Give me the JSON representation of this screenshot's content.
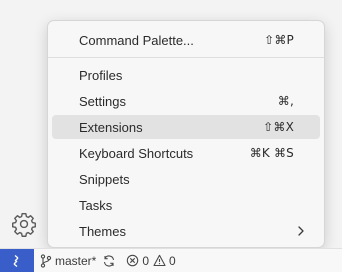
{
  "menu": {
    "items": [
      {
        "label": "Command Palette...",
        "shortcut": "⇧⌘P"
      },
      {
        "label": "Profiles",
        "shortcut": ""
      },
      {
        "label": "Settings",
        "shortcut": "⌘,"
      },
      {
        "label": "Extensions",
        "shortcut": "⇧⌘X"
      },
      {
        "label": "Keyboard Shortcuts",
        "shortcut": "⌘K ⌘S"
      },
      {
        "label": "Snippets",
        "shortcut": ""
      },
      {
        "label": "Tasks",
        "shortcut": ""
      },
      {
        "label": "Themes",
        "shortcut": ""
      }
    ]
  },
  "statusbar": {
    "branch": "master*",
    "errors": "0",
    "warnings": "0"
  },
  "icons": {
    "manage": "gear-icon",
    "remote": "remote-icon",
    "branch": "git-branch-icon",
    "sync": "sync-icon",
    "errors": "error-icon",
    "warnings": "warning-icon",
    "submenu": "chevron-right-icon"
  },
  "colors": {
    "remote_indicator": "#3a5ec9",
    "menu_highlight": "#e2e2e2"
  }
}
